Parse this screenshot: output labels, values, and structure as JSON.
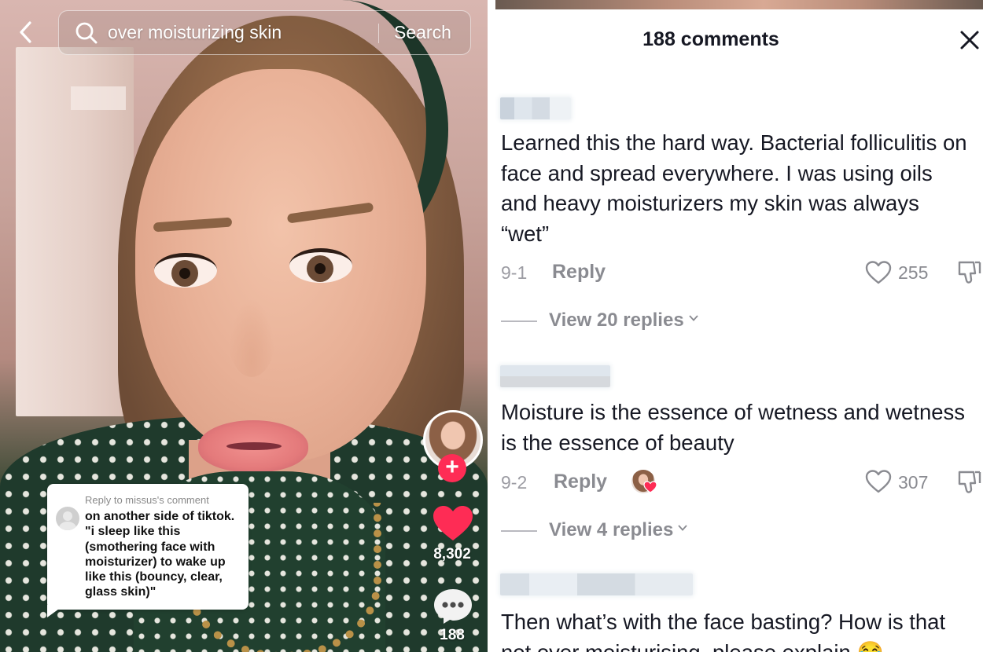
{
  "search": {
    "query": "over moisturizing skin",
    "button_label": "Search"
  },
  "video": {
    "reply_card": {
      "header": "Reply to missus's comment",
      "text": "on another side of tiktok. \"i sleep like this (smothering face with moisturizer) to wake up like this (bouncy, clear, glass skin)\""
    },
    "like_count": "8,302",
    "comment_count": "188",
    "follow_label": "+"
  },
  "comments_panel": {
    "title": "188 comments",
    "comments": [
      {
        "text": "Learned this the hard way. Bacterial folliculitis on face and spread everywhere. I was using oils and heavy moisturizers my skin was always “wet”",
        "date": "9-1",
        "reply_label": "Reply",
        "likes": "255",
        "view_replies": "View 20 replies"
      },
      {
        "text": "Moisture is the essence of wetness and wetness is the essence of beauty",
        "date": "9-2",
        "reply_label": "Reply",
        "likes": "307",
        "view_replies": "View 4 replies"
      },
      {
        "text": "Then what’s with the face basting? How is that not over moisturising, please explain 😂",
        "date": "",
        "reply_label": "",
        "likes": "",
        "view_replies": ""
      }
    ]
  },
  "colors": {
    "accent_red": "#fe2c55",
    "text_primary": "#161823",
    "text_secondary": "#8a8b91"
  },
  "icons": [
    "back-icon",
    "search-icon",
    "heart-icon",
    "comment-icon",
    "close-icon",
    "heart-outline-icon",
    "dislike-icon",
    "chevron-down-icon"
  ]
}
